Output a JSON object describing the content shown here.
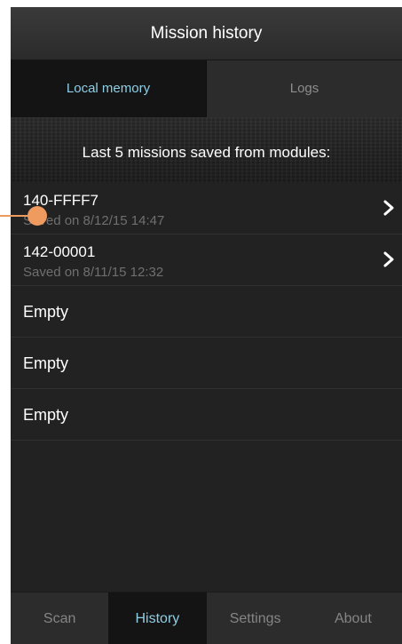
{
  "header": {
    "title": "Mission history"
  },
  "tabs": [
    {
      "label": "Local memory",
      "active": true
    },
    {
      "label": "Logs",
      "active": false
    }
  ],
  "banner": {
    "text": "Last 5 missions saved from modules:"
  },
  "missions": [
    {
      "id": "140-FFFF7",
      "saved": "Saved on 8/12/15 14:47"
    },
    {
      "id": "142-00001",
      "saved": "Saved on 8/11/15 12:32"
    }
  ],
  "empty_slots": [
    {
      "label": "Empty"
    },
    {
      "label": "Empty"
    },
    {
      "label": "Empty"
    }
  ],
  "bottom_nav": [
    {
      "label": "Scan",
      "active": false
    },
    {
      "label": "History",
      "active": true
    },
    {
      "label": "Settings",
      "active": false
    },
    {
      "label": "About",
      "active": false
    }
  ],
  "icons": {
    "row_chevron": "chevron-right-icon"
  },
  "colors": {
    "accent": "#8ecfe6",
    "background": "#222223",
    "marker": "#ef9a5e"
  }
}
